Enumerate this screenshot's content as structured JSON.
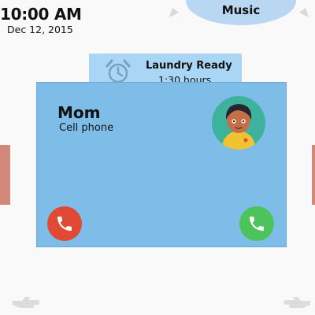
{
  "clock": {
    "time": "10:00 AM",
    "date": "Dec 12, 2015"
  },
  "music": {
    "label": "Music"
  },
  "notification": {
    "title": "Laundry Ready",
    "subtitle": "1:30 hours",
    "icon": "alarm-clock-icon"
  },
  "call": {
    "caller_name": "Mom",
    "caller_type": "Cell phone",
    "decline_icon": "phone-decline-icon",
    "accept_icon": "phone-accept-icon"
  },
  "colors": {
    "card": "#7fbde9",
    "decline": "#e04a35",
    "accept": "#4cc45b",
    "notification": "#a9d6f5",
    "music_pill": "#b9d6f2",
    "side_bar": "#d3877b"
  }
}
